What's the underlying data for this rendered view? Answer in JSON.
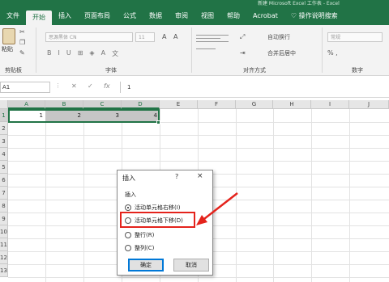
{
  "window": {
    "title": "新建 Microsoft Excel 工作表 - Excel",
    "colors": {
      "accent": "#217346",
      "highlight": "#e4231c",
      "dialog_default_border": "#0078d7"
    }
  },
  "ribbon_tabs": [
    "文件",
    "开始",
    "插入",
    "页面布局",
    "公式",
    "数据",
    "审阅",
    "视图",
    "帮助",
    "Acrobat",
    "操作说明搜索"
  ],
  "active_tab": "开始",
  "ribbon": {
    "clipboard": {
      "paste_label": "粘贴",
      "group_label": "剪贴板"
    },
    "font": {
      "name": "思源黑体 CN",
      "size": "11",
      "group_label": "字体"
    },
    "alignment": {
      "wrap_label": "自动换行",
      "merge_label": "合并后居中",
      "group_label": "对齐方式"
    },
    "number": {
      "format": "常规",
      "format_buttons": "% ,",
      "group_label": "数字"
    }
  },
  "formula_bar": {
    "name_box": "A1",
    "fx_label": "fx",
    "value": "1"
  },
  "grid": {
    "columns": [
      "A",
      "B",
      "C",
      "D",
      "E",
      "F",
      "G",
      "H",
      "I",
      "J"
    ],
    "rows": [
      "1",
      "2",
      "3",
      "4",
      "5",
      "6",
      "7",
      "8",
      "9",
      "10",
      "11",
      "12",
      "13"
    ],
    "row1_values": [
      "1",
      "2",
      "3",
      "4"
    ]
  },
  "dialog": {
    "title": "插入",
    "help": "?",
    "close": "×",
    "group_label": "插入",
    "options": [
      {
        "label": "活动单元格右移(I)",
        "checked": true
      },
      {
        "label": "活动单元格下移(D)",
        "checked": false
      },
      {
        "label": "整行(R)",
        "checked": false
      },
      {
        "label": "整列(C)",
        "checked": false
      }
    ],
    "ok": "确定",
    "cancel": "取消"
  }
}
